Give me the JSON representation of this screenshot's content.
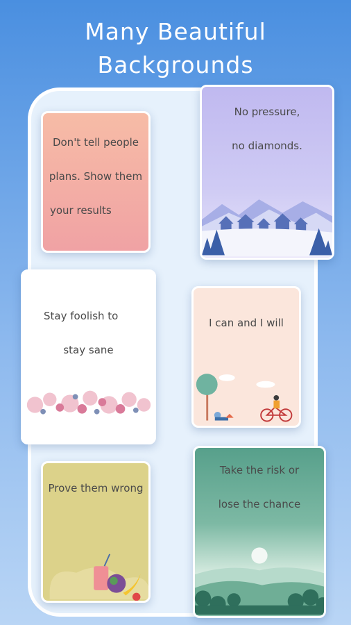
{
  "header": {
    "line1": "Many Beautiful",
    "line2": "Backgrounds"
  },
  "cards": [
    {
      "lines": [
        "Don't tell people",
        "plans. Show them",
        "your results"
      ],
      "background": "#f3a8a6"
    },
    {
      "lines": [
        "No pressure,",
        "no diamonds."
      ],
      "background": "#c9c3f2"
    },
    {
      "lines": [
        "Stay foolish to",
        "stay sane"
      ],
      "background": "#ffffff"
    },
    {
      "lines": [
        "I can and I will"
      ],
      "background": "#fbe6dc"
    },
    {
      "lines": [
        "Prove them wrong"
      ],
      "background": "#dcd28a"
    },
    {
      "lines": [
        "Take the risk or",
        "lose the chance"
      ],
      "background": "#5fa791"
    }
  ],
  "icons": [
    "snowy-village-illustration",
    "flower-garland-illustration",
    "cyclist-park-illustration",
    "fruit-drink-illustration",
    "forest-sunrise-illustration"
  ]
}
